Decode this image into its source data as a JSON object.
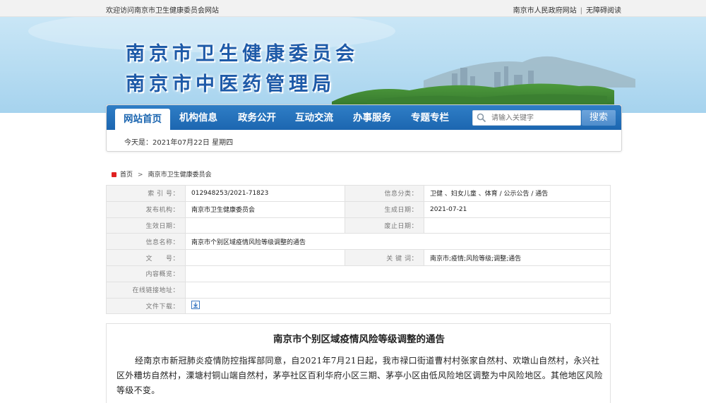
{
  "topbar": {
    "welcome": "欢迎访问南京市卫生健康委员会网站",
    "gov_link": "南京市人民政府网站",
    "separator": "|",
    "accessible_link": "无障碍阅读"
  },
  "banner": {
    "title_line1": "南京市卫生健康委员会",
    "title_line2": "南京市中医药管理局"
  },
  "nav": {
    "items": [
      "网站首页",
      "机构信息",
      "政务公开",
      "互动交流",
      "办事服务",
      "专题专栏"
    ],
    "active": "网站首页",
    "search_placeholder": "请输入关键字",
    "search_button": "搜索",
    "date_text": "今天是：2021年07月22日 星期四"
  },
  "breadcrumb": {
    "home": "首页",
    "arrow": ">",
    "current": "南京市卫生健康委员会"
  },
  "meta": {
    "index_label": "索 引 号：",
    "index_value": "012948253/2021-71823",
    "category_label": "信息分类：",
    "category_value": "卫健 、妇女儿童 、体育 / 公示公告 / 通告",
    "publisher_label": "发布机构：",
    "publisher_value": "南京市卫生健康委员会",
    "generated_label": "生成日期：",
    "generated_value": "2021-07-21",
    "effective_label": "生效日期：",
    "effective_value": "",
    "expire_label": "废止日期：",
    "expire_value": "",
    "name_label": "信息名称：",
    "name_value": "南京市个别区域疫情风险等级调整的通告",
    "doc_no_label": "文　　号：",
    "doc_no_value": "",
    "keywords_label": "关 键 词：",
    "keywords_value": "南京市;疫情;风险等级;调整;通告",
    "summary_label": "内容概览：",
    "summary_value": "",
    "link_label": "在线链接地址：",
    "link_value": "",
    "download_label": "文件下载："
  },
  "article": {
    "title": "南京市个别区域疫情风险等级调整的通告",
    "body": "经南京市新冠肺炎疫情防控指挥部同意，自2021年7月21日起，我市禄口街道曹村村张家自然村、欢墩山自然村，永兴社区外糟坊自然村，溧塘村铜山端自然村，茅亭社区百利华府小区三期、茅亭小区由低风险地区调整为中风险地区。其他地区风险等级不变。"
  },
  "colors": {
    "nav_blue": "#1c66b0",
    "title_blue": "#1e5aa8",
    "home_red": "#e02020"
  },
  "icons": {
    "search": "search-icon",
    "home": "home-icon",
    "download": "download-icon"
  }
}
